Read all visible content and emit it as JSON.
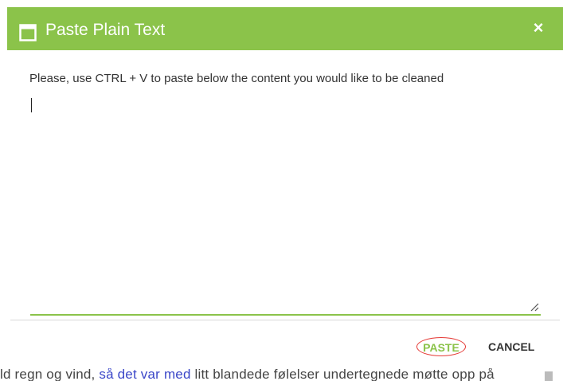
{
  "dialog": {
    "title": "Paste Plain Text",
    "close_label": "×",
    "instruction": "Please, use CTRL + V to paste below the content you would like to be cleaned",
    "textarea_value": "",
    "buttons": {
      "paste": "PASTE",
      "cancel": "CANCEL"
    },
    "header_color": "#8bc34a",
    "highlight_color": "#e53935"
  },
  "background": {
    "text_before": "ld regn og vind, ",
    "link_text": "så det var med",
    "text_after": " litt blandede følelser undertegnede møtte opp på"
  }
}
